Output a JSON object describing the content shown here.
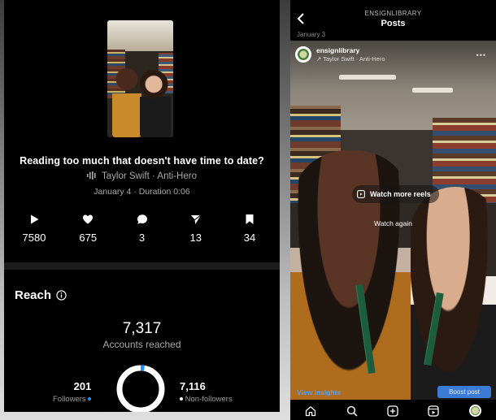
{
  "left": {
    "caption": "Reading too much that doesn't have time to date?",
    "audio": "Taylor Swift · Anti-Hero",
    "meta": "January 4 · Duration 0:06",
    "stats": [
      {
        "icon": "play-icon",
        "value": "7580"
      },
      {
        "icon": "heart-icon",
        "value": "675"
      },
      {
        "icon": "comment-icon",
        "value": "3"
      },
      {
        "icon": "share-icon",
        "value": "13"
      },
      {
        "icon": "bookmark-icon",
        "value": "34"
      }
    ],
    "reach": {
      "title": "Reach",
      "accounts_reached": "7,317",
      "accounts_label": "Accounts reached",
      "followers_value": "201",
      "followers_label": "Followers",
      "non_followers_value": "7,116",
      "non_followers_label": "Non-followers",
      "followers_fraction": 0.027,
      "followers_color": "#1e90ff",
      "non_followers_color": "#ffffff"
    }
  },
  "right": {
    "header_username": "ENSIGNLIBRARY",
    "header_title": "Posts",
    "date_fragment": "January 3",
    "post": {
      "username": "ensignlibrary",
      "audio": "↗ Taylor Swift · Anti-Hero",
      "watch_more": "Watch more reels",
      "watch_again": "Watch again",
      "view_insights": "View insights",
      "boost": "Boost post"
    },
    "nav_icons": [
      "home-icon",
      "search-icon",
      "create-icon",
      "reels-icon",
      "profile-icon"
    ]
  }
}
